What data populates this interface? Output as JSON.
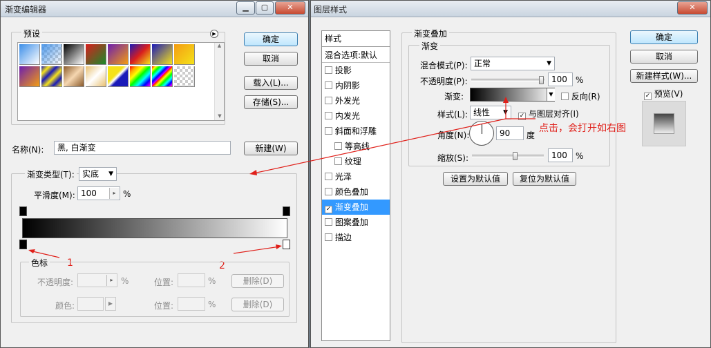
{
  "gradient_editor": {
    "title": "渐变编辑器",
    "presets_label": "预设",
    "ok": "确定",
    "cancel": "取消",
    "load": "载入(L)...",
    "save": "存储(S)...",
    "name_label": "名称(N):",
    "name_value": "黑, 白渐变",
    "new": "新建(W)",
    "type_label": "渐变类型(T):",
    "type_value": "实底",
    "smooth_label": "平滑度(M):",
    "smooth_value": "100",
    "percent": "%",
    "color_stops_label": "色标",
    "opacity_label": "不透明度:",
    "location_label": "位置:",
    "delete_label": "删除(D)",
    "color_label": "颜色:",
    "annotation_1": "1",
    "annotation_2": "2"
  },
  "layer_style": {
    "title": "图层样式",
    "styles_header": "样式",
    "items": [
      {
        "label": "混合选项:默认",
        "checkbox": false
      },
      {
        "label": "投影",
        "checkbox": true,
        "checked": false
      },
      {
        "label": "内阴影",
        "checkbox": true,
        "checked": false
      },
      {
        "label": "外发光",
        "checkbox": true,
        "checked": false
      },
      {
        "label": "内发光",
        "checkbox": true,
        "checked": false
      },
      {
        "label": "斜面和浮雕",
        "checkbox": true,
        "checked": false
      },
      {
        "label": "等高线",
        "checkbox": true,
        "checked": false
      },
      {
        "label": "纹理",
        "checkbox": true,
        "checked": false
      },
      {
        "label": "光泽",
        "checkbox": true,
        "checked": false
      },
      {
        "label": "颜色叠加",
        "checkbox": true,
        "checked": false
      },
      {
        "label": "渐变叠加",
        "checkbox": true,
        "checked": true,
        "selected": true
      },
      {
        "label": "图案叠加",
        "checkbox": true,
        "checked": false
      },
      {
        "label": "描边",
        "checkbox": true,
        "checked": false
      }
    ],
    "section_title": "渐变叠加",
    "subsection_title": "渐变",
    "blend_mode_label": "混合模式(P):",
    "blend_mode_value": "正常",
    "opacity_label": "不透明度(P):",
    "opacity_value": "100",
    "gradient_label": "渐变:",
    "reverse_label": "反向(R)",
    "style_label": "样式(L):",
    "style_value": "线性",
    "align_label": "与图层对齐(I)",
    "angle_label": "角度(N):",
    "angle_value": "90",
    "degree": "度",
    "scale_label": "缩放(S):",
    "scale_value": "100",
    "percent": "%",
    "set_default": "设置为默认值",
    "reset_default": "复位为默认值",
    "ok": "确定",
    "cancel": "取消",
    "new_style": "新建样式(W)...",
    "preview_label": "预览(V)",
    "annotation": "点击，会打开如右图"
  },
  "colors": {
    "selection": "#3399ff",
    "annotation_red": "#e0201a"
  }
}
